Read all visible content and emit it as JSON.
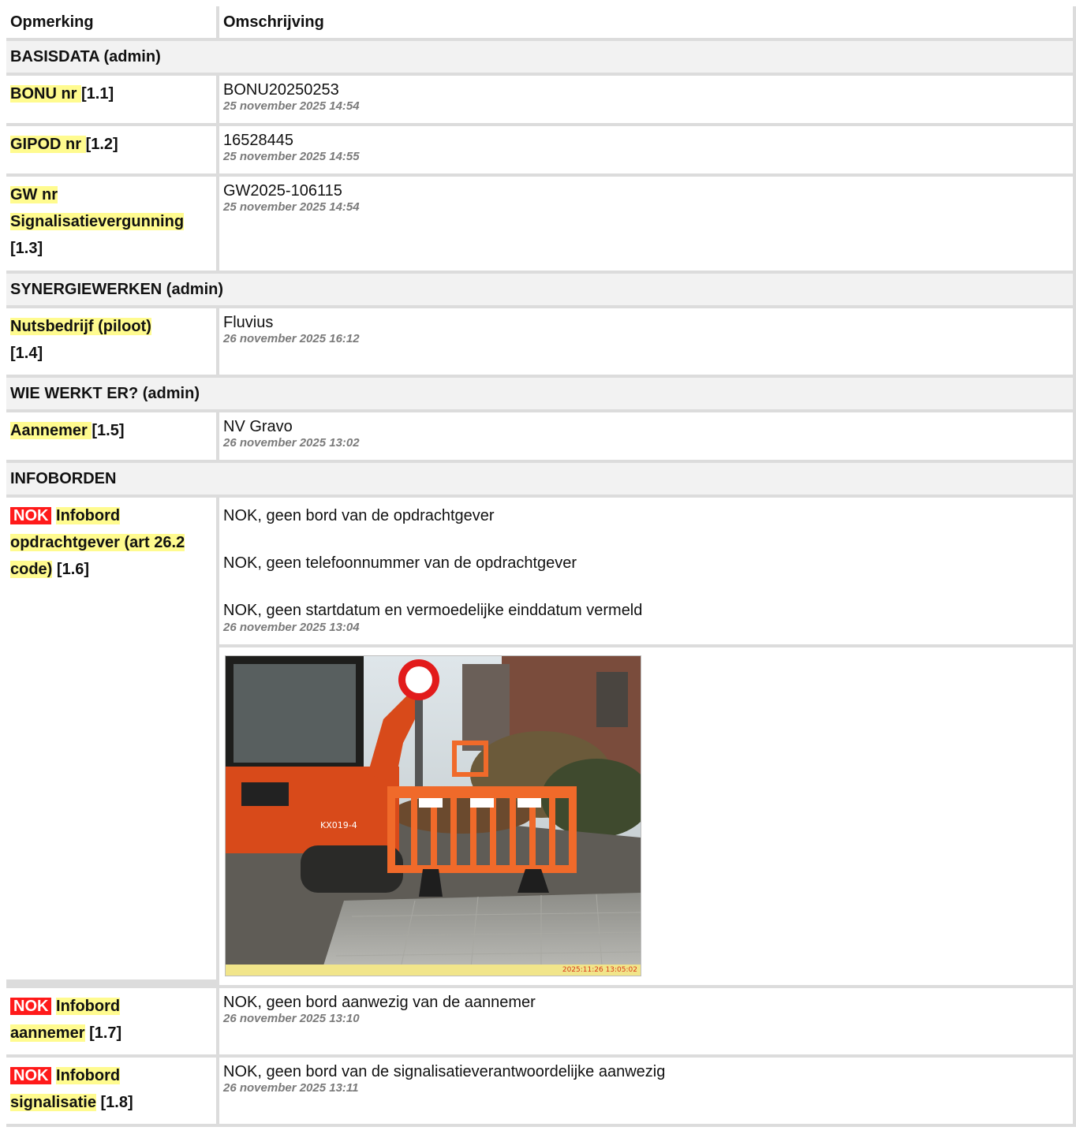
{
  "header": {
    "col1": "Opmerking",
    "col2": "Omschrijving"
  },
  "sections": {
    "basisdata": "BASISDATA (admin)",
    "synergie": "SYNERGIEWERKEN (admin)",
    "wie": "WIE WERKT ER? (admin)",
    "infoborden": "INFOBORDEN"
  },
  "rows": {
    "bonu": {
      "label": "BONU nr ",
      "ref": "[1.1]",
      "value": "BONU20250253",
      "ts": "25 november 2025 14:54"
    },
    "gipod": {
      "label": "GIPOD nr ",
      "ref": "[1.2]",
      "value": "16528445",
      "ts": "25 november 2025 14:55"
    },
    "gw": {
      "label_line1": "GW nr",
      "label_line2": "Signalisatievergunning",
      "ref": "[1.3]",
      "value": "GW2025-106115",
      "ts": "25 november 2025 14:54"
    },
    "nuts": {
      "label": "Nutsbedrijf (piloot) ",
      "ref": "[1.4]",
      "value": "Fluvius",
      "ts": "26 november 2025 16:12"
    },
    "aannemer": {
      "label": "Aannemer ",
      "ref": "[1.5]",
      "value": "NV Gravo",
      "ts": "26 november 2025 13:02"
    },
    "ib_opdracht": {
      "badge": "NOK",
      "label_line1": "Infobord",
      "label_line2": "opdrachtgever (art 26.2",
      "label_line3": "code)",
      "ref": "[1.6]",
      "p1": "NOK, geen bord van de opdrachtgever",
      "p2": "NOK, geen telefoonnummer van de opdrachtgever",
      "p3": "NOK, geen startdatum en vermoedelijke einddatum vermeld",
      "ts": "26 november 2025 13:04",
      "photo_stamp": "2025:11:26 13:05:02"
    },
    "ib_aannemer": {
      "badge": "NOK",
      "label_line1": "Infobord",
      "label_line2": "aannemer",
      "ref": "[1.7]",
      "value": "NOK, geen bord aanwezig van de aannemer",
      "ts": "26 november 2025 13:10"
    },
    "ib_signal": {
      "badge": "NOK",
      "label_line1": "Infobord",
      "label_line2": "signalisatie",
      "ref": "[1.8]",
      "value": "NOK, geen bord van de signalisatieverantwoordelijke aanwezig",
      "ts": "26 november 2025 13:11"
    }
  },
  "colors": {
    "highlight": "#fffb8f",
    "nok": "#ff1a1a",
    "border": "#dcdcdc",
    "section_bg": "#f2f2f2"
  }
}
